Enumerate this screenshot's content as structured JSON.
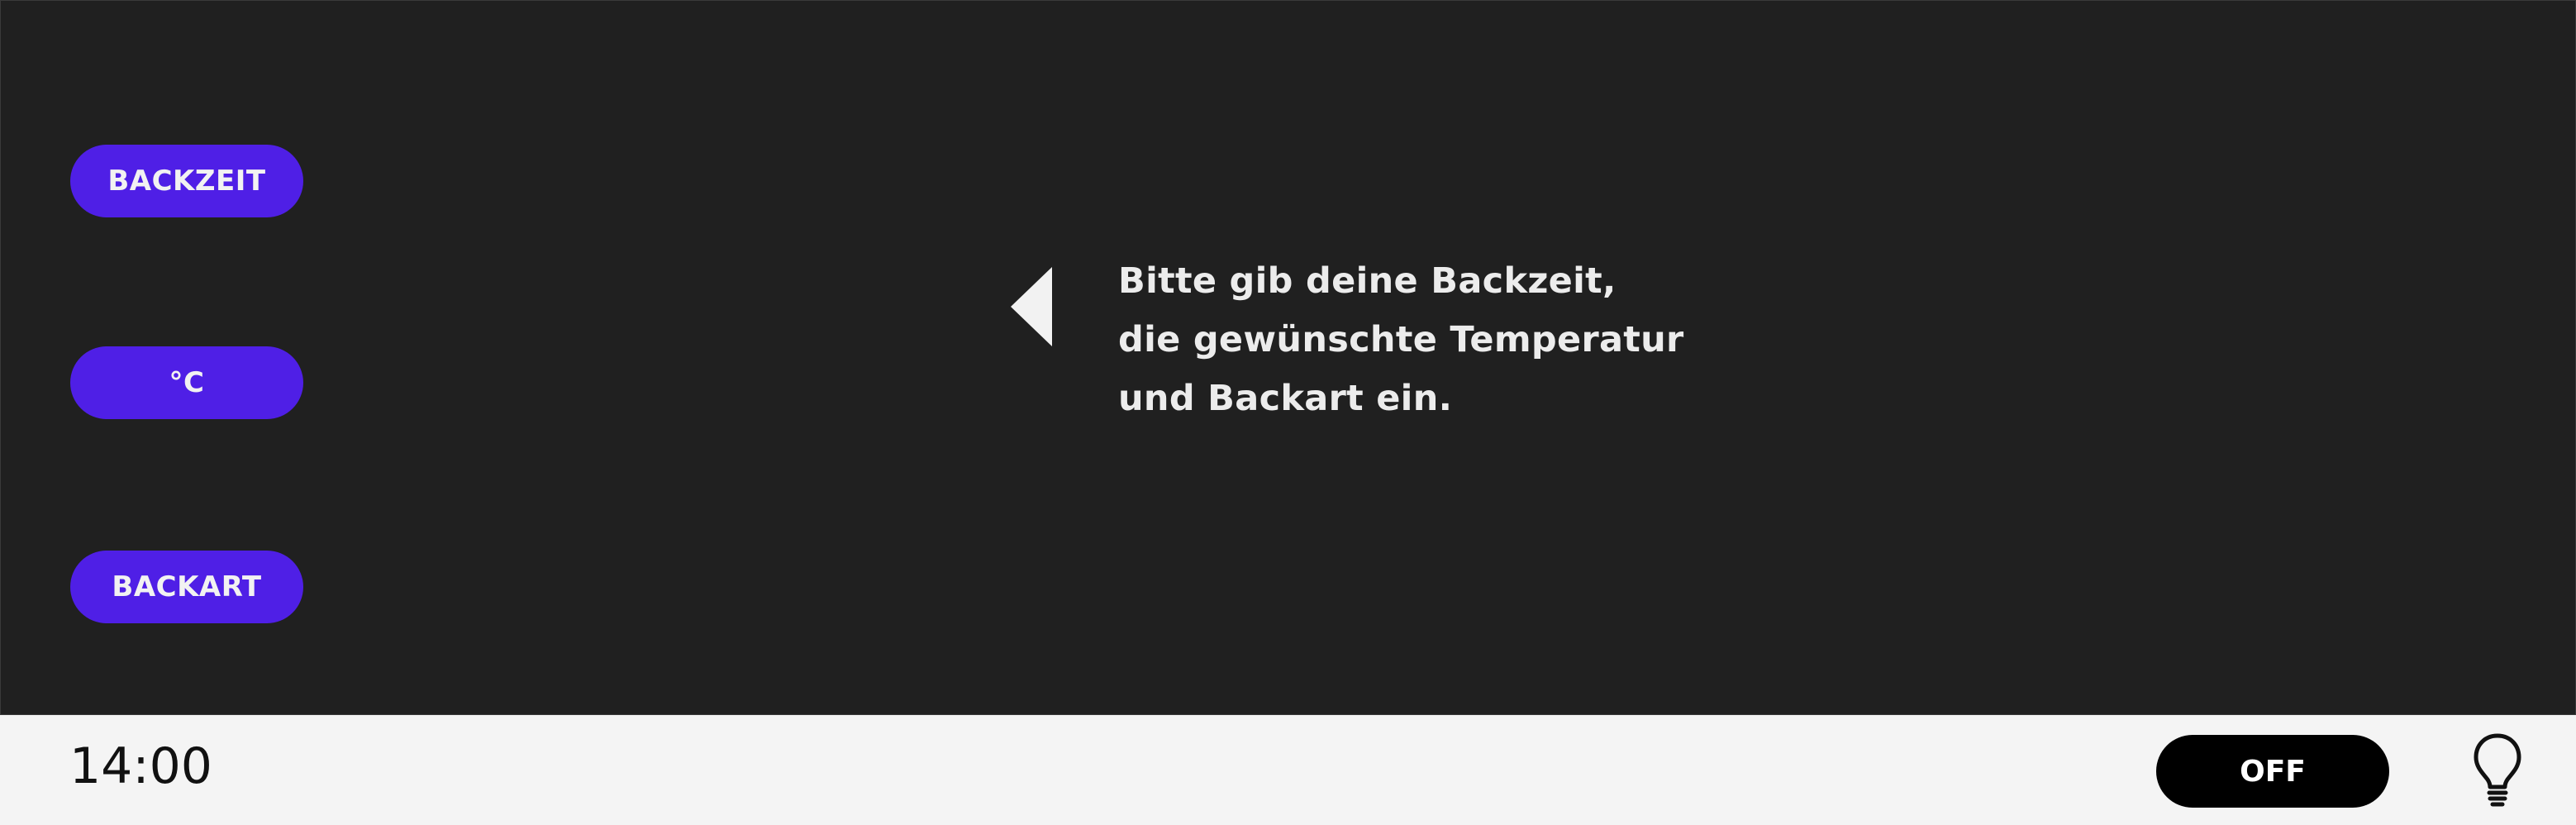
{
  "menu": {
    "items": [
      {
        "label": "BACKZEIT"
      },
      {
        "label": "°C"
      },
      {
        "label": "BACKART"
      }
    ]
  },
  "instruction": {
    "lines": [
      "Bitte gib deine Backzeit,",
      "die gewünschte Temperatur",
      "und Backart ein."
    ],
    "pointer_icon": "triangle-left-icon"
  },
  "statusbar": {
    "time": "14:00",
    "power_label": "OFF",
    "light_icon": "lightbulb-icon"
  },
  "colors": {
    "panel_bg": "#202020",
    "accent": "#4f1fe6",
    "bar_bg": "#f4f4f4",
    "text_light": "#ececec",
    "button_dark": "#000000"
  }
}
